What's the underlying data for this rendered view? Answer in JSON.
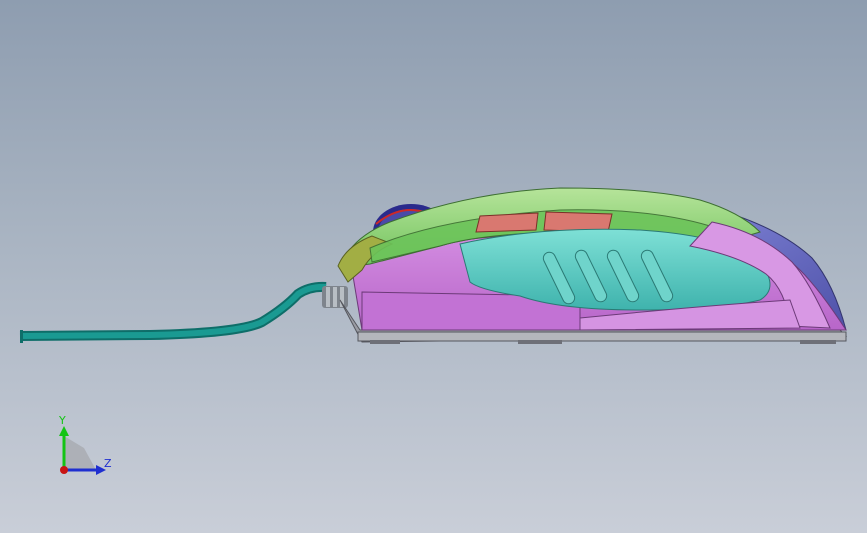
{
  "viewport": {
    "background_top": "#8e9db0",
    "background_bottom": "#c9ced8"
  },
  "model": {
    "name": "computer-mouse",
    "view": "side",
    "colors": {
      "cable": "#14857f",
      "cable_strain_relief": "#8a9096",
      "shell_top_green": "#7ed36a",
      "shell_top_dark_green": "#58a84a",
      "shell_olive": "#a2ae44",
      "side_magenta": "#c97ad9",
      "side_light_magenta": "#dc9ee8",
      "thumb_grip_teal": "#5fcbc4",
      "rear_blue": "#5c5fb8",
      "scroll_wheel_blue": "#2a2a8c",
      "side_buttons_salmon": "#d97870",
      "base_grey": "#9a9ca4",
      "feet_grey": "#6e7078"
    },
    "icons": [
      "cable-icon",
      "scroll-wheel-icon",
      "side-button-icon",
      "grip-groove-icon",
      "mouse-foot-icon"
    ]
  },
  "triad": {
    "y_label": "Y",
    "z_label": "Z",
    "colors": {
      "y": "#14c414",
      "z": "#1f2fd0",
      "origin": "#c81414"
    }
  }
}
